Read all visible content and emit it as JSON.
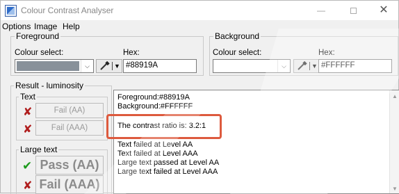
{
  "window": {
    "title": "Colour Contrast Analyser",
    "minimize_symbol": "—",
    "close_symbol": "✕"
  },
  "menu": {
    "items": [
      "Options",
      "Image",
      "Help"
    ]
  },
  "foreground": {
    "group_title": "Foreground",
    "colour_select_label": "Colour select:",
    "hex_label": "Hex:",
    "hex_value": "#88919A",
    "swatch_color": "#88919A"
  },
  "background": {
    "group_title": "Background",
    "colour_select_label": "Colour select:",
    "hex_label": "Hex:",
    "hex_value": "#FFFFFF",
    "swatch_color": "#FFFFFF"
  },
  "result": {
    "group_title": "Result - luminosity",
    "text_group_title": "Text",
    "large_text_group_title": "Large text",
    "text_aa": {
      "label": "Fail (AA)",
      "status": "fail"
    },
    "text_aaa": {
      "label": "Fail (AAA)",
      "status": "fail"
    },
    "large_aa": {
      "label": "Pass (AA)",
      "status": "pass"
    },
    "large_aaa": {
      "label": "Fail (AAA)",
      "status": "fail"
    }
  },
  "results_panel": {
    "lines": [
      "Foreground:#88919A",
      "Background:#FFFFFF",
      "The contrast ratio is: 3.2:1",
      "Text failed at Level AA",
      "Text failed at Level AAA",
      "Large text passed at Level AA",
      "Large text failed at Level AAA"
    ],
    "highlight_color": "#DD5A3E"
  },
  "icons": {
    "fail": "x-icon",
    "pass": "checkmark-icon",
    "picker": "eyedropper-icon"
  },
  "colors": {
    "fail": "#B01E1E",
    "pass": "#1C9A1C"
  }
}
